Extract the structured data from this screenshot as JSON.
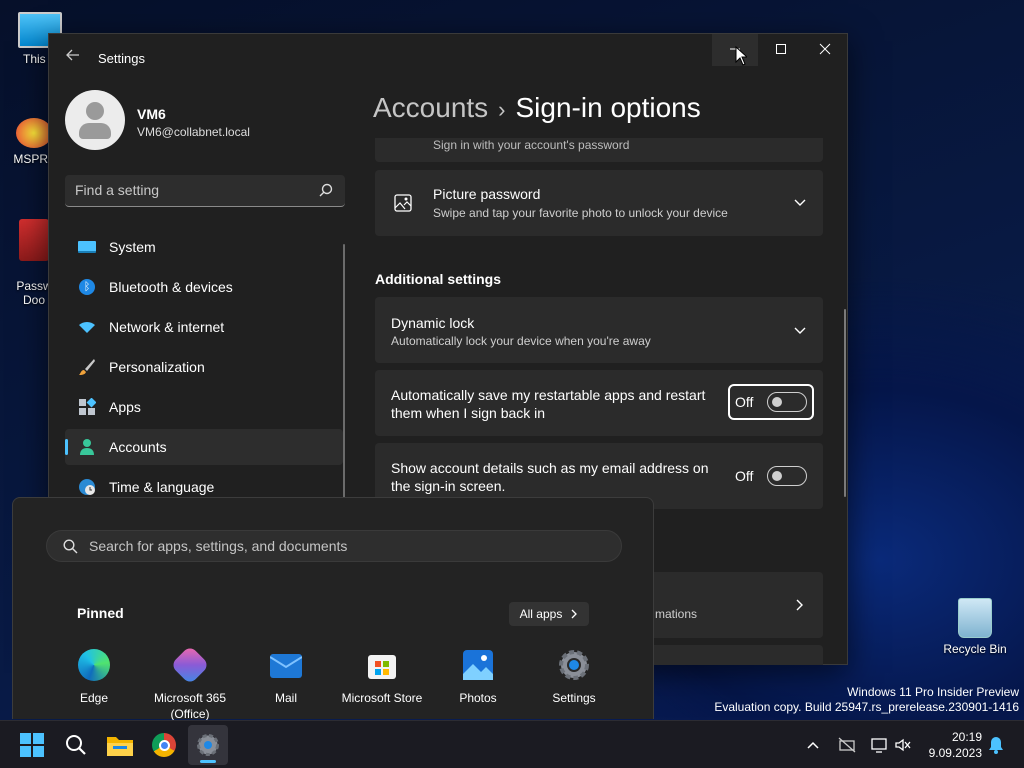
{
  "desktop": {
    "icons": [
      {
        "label": "This P"
      },
      {
        "label": "MSPRe"
      },
      {
        "label": "Passw\nDoo"
      },
      {
        "label": "Recycle Bin"
      }
    ]
  },
  "settings": {
    "title": "Settings",
    "user": {
      "name": "VM6",
      "email": "VM6@collabnet.local"
    },
    "search": {
      "placeholder": "Find a setting"
    },
    "nav": [
      {
        "label": "System",
        "icon": "system-icon"
      },
      {
        "label": "Bluetooth & devices",
        "icon": "bluetooth-icon"
      },
      {
        "label": "Network & internet",
        "icon": "wifi-icon"
      },
      {
        "label": "Personalization",
        "icon": "brush-icon"
      },
      {
        "label": "Apps",
        "icon": "apps-icon"
      },
      {
        "label": "Accounts",
        "icon": "person-icon",
        "active": true
      },
      {
        "label": "Time & language",
        "icon": "globe-clock-icon"
      }
    ],
    "breadcrumb": {
      "parent": "Accounts",
      "separator": "›",
      "current": "Sign-in options"
    },
    "partial_card": {
      "subtitle": "Sign in with your account's password"
    },
    "picture_password": {
      "title": "Picture password",
      "subtitle": "Swipe and tap your favorite photo to unlock your device"
    },
    "additional_settings": "Additional settings",
    "dynamic_lock": {
      "title": "Dynamic lock",
      "subtitle": "Automatically lock your device when you're away"
    },
    "restart_apps": {
      "line1": "Automatically save my restartable apps and restart",
      "line2": "them when I sign back in",
      "state": "Off"
    },
    "account_details": {
      "line1": "Show account details such as my email address on",
      "line2": "the sign-in screen.",
      "state": "Off"
    },
    "partial_bottom": {
      "subtitle": "mations"
    }
  },
  "start": {
    "search_placeholder": "Search for apps, settings, and documents",
    "pinned": "Pinned",
    "all_apps": "All apps",
    "apps": [
      {
        "line1": "Edge",
        "line2": ""
      },
      {
        "line1": "Microsoft 365",
        "line2": "(Office)"
      },
      {
        "line1": "Mail",
        "line2": ""
      },
      {
        "line1": "Microsoft Store",
        "line2": ""
      },
      {
        "line1": "Photos",
        "line2": ""
      },
      {
        "line1": "Settings",
        "line2": ""
      }
    ]
  },
  "watermark": {
    "line1": "Windows 11 Pro Insider Preview",
    "line2": "Evaluation copy. Build 25947.rs_prerelease.230901-1416"
  },
  "taskbar": {
    "time": "20:19",
    "date": "9.09.2023"
  },
  "colors": {
    "accent": "#4cc2ff",
    "window_bg": "#202020",
    "card_bg": "#2b2b2b"
  }
}
